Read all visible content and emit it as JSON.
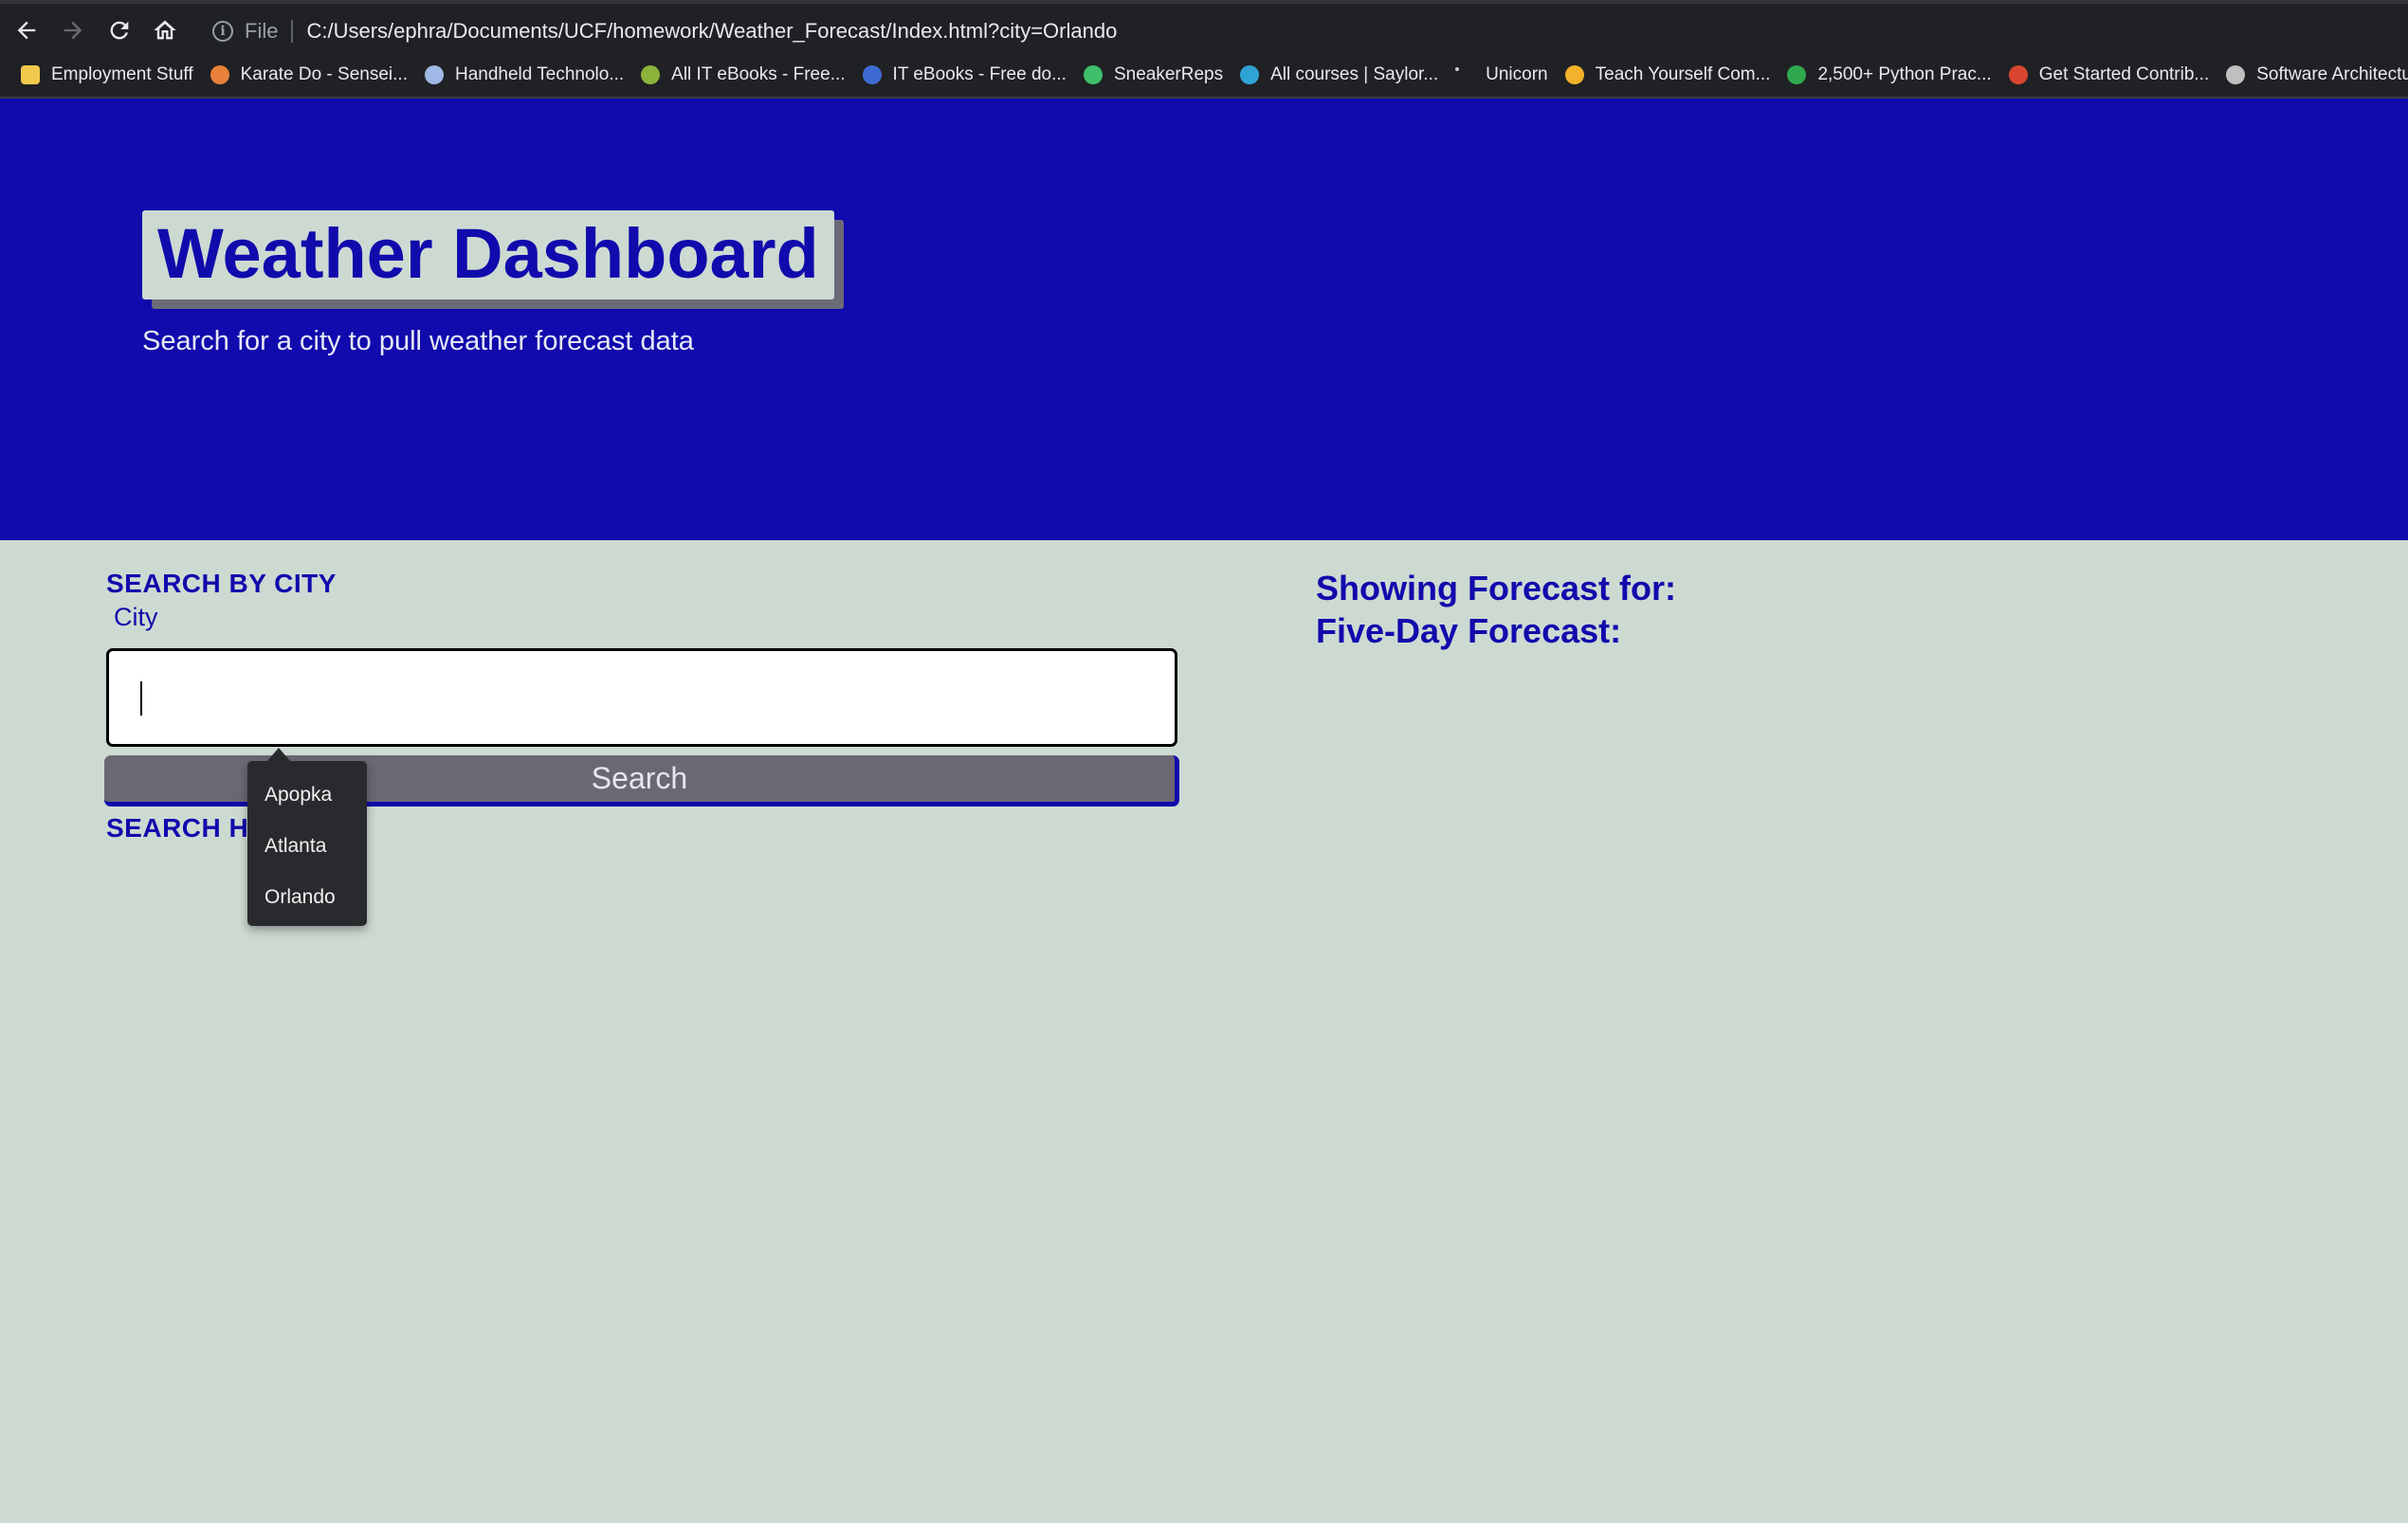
{
  "browser": {
    "address": {
      "protocol_label": "File",
      "url": "C:/Users/ephra/Documents/UCF/homework/Weather_Forecast/Index.html?city=Orlando"
    },
    "bookmarks": [
      {
        "label": "Employment Stuff",
        "icon": "folder-icon",
        "color": "#f2c94c"
      },
      {
        "label": "Karate Do - Sensei...",
        "icon": "karate-icon",
        "color": "#e8823a"
      },
      {
        "label": "Handheld Technolo...",
        "icon": "owl-icon",
        "color": "#9fb8e6"
      },
      {
        "label": "All IT eBooks - Free...",
        "icon": "book-icon",
        "color": "#8bb33a"
      },
      {
        "label": "IT eBooks - Free do...",
        "icon": "ebook-icon",
        "color": "#3d6bd1"
      },
      {
        "label": "SneakerReps",
        "icon": "sneaker-icon",
        "color": "#3fbf6a"
      },
      {
        "label": "All courses | Saylor...",
        "icon": "saylor-icon",
        "color": "#2fa3d6"
      },
      {
        "label": "Unicorn",
        "icon": "unicorn-icon",
        "color": "#cfcfcf"
      },
      {
        "label": "Teach Yourself Com...",
        "icon": "key-icon",
        "color": "#f2b22b"
      },
      {
        "label": "2,500+ Python Prac...",
        "icon": "python-icon",
        "color": "#2fa84f"
      },
      {
        "label": "Get Started Contrib...",
        "icon": "contrib-icon",
        "color": "#d9452f"
      },
      {
        "label": "Software Architectu...",
        "icon": "globe-icon",
        "color": "#bfbfbf"
      }
    ]
  },
  "header": {
    "title": "Weather Dashboard",
    "subtitle": "Search for a city to pull weather forecast data"
  },
  "search": {
    "heading": "SEARCH BY CITY",
    "label": "City",
    "input_value": "",
    "button_label": "Search",
    "history_heading": "SEARCH H"
  },
  "autocomplete": {
    "options": [
      "Apopka",
      "Atlanta",
      "Orlando"
    ]
  },
  "forecast": {
    "showing_label": "Showing Forecast for:",
    "five_day_label": "Five-Day Forecast:"
  },
  "colors": {
    "hero_bg": "#110aac",
    "page_bg": "#cddad2",
    "button_bg": "#6b6873"
  }
}
